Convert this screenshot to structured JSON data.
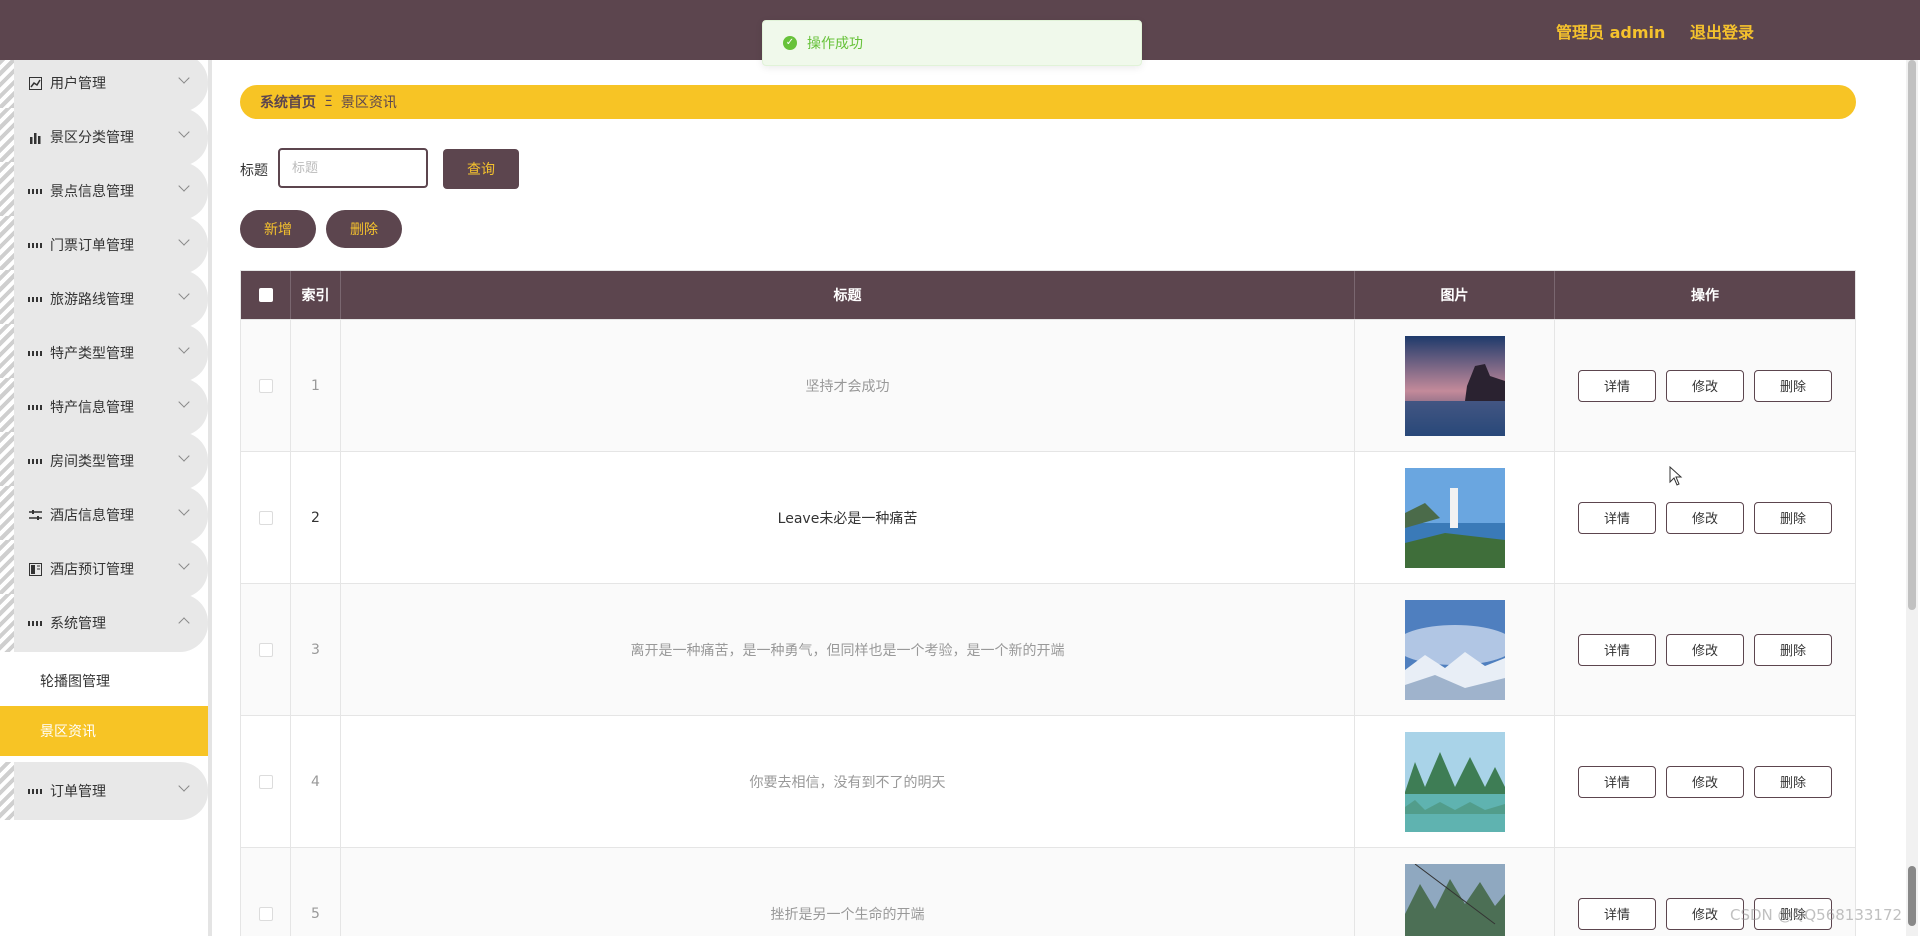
{
  "header": {
    "user": "管理员 admin",
    "logout": "退出登录"
  },
  "toast": {
    "message": "操作成功"
  },
  "sidebar": {
    "items": [
      {
        "label": "用户管理",
        "icon": "chart-line-icon"
      },
      {
        "label": "景区分类管理",
        "icon": "bar-chart-icon"
      },
      {
        "label": "景点信息管理",
        "icon": "grid-icon"
      },
      {
        "label": "门票订单管理",
        "icon": "grid-icon"
      },
      {
        "label": "旅游路线管理",
        "icon": "grid-icon"
      },
      {
        "label": "特产类型管理",
        "icon": "grid-icon"
      },
      {
        "label": "特产信息管理",
        "icon": "grid-icon"
      },
      {
        "label": "房间类型管理",
        "icon": "grid-icon"
      },
      {
        "label": "酒店信息管理",
        "icon": "sliders-icon"
      },
      {
        "label": "酒店预订管理",
        "icon": "book-icon"
      },
      {
        "label": "系统管理",
        "icon": "grid-icon"
      },
      {
        "label": "订单管理",
        "icon": "grid-icon"
      }
    ],
    "sub_items": [
      {
        "label": "轮播图管理"
      },
      {
        "label": "景区资讯"
      }
    ]
  },
  "breadcrumb": {
    "home": "系统首页",
    "separator": "Ξ",
    "current": "景区资讯"
  },
  "search": {
    "label": "标题",
    "placeholder": "标题",
    "button": "查询"
  },
  "actions": {
    "add": "新增",
    "delete": "删除"
  },
  "table": {
    "columns": [
      "索引",
      "标题",
      "图片",
      "操作"
    ],
    "row_buttons": {
      "detail": "详情",
      "edit": "修改",
      "delete": "删除"
    },
    "rows": [
      {
        "index": "1",
        "title": "坚持才会成功"
      },
      {
        "index": "2",
        "title": "Leave未必是一种痛苦"
      },
      {
        "index": "3",
        "title": "离开是一种痛苦，是一种勇气，但同样也是一个考验，是一个新的开端"
      },
      {
        "index": "4",
        "title": "你要去相信，没有到不了的明天"
      },
      {
        "index": "5",
        "title": "挫折是另一个生命的开端"
      }
    ]
  },
  "watermark": "CSDN @QQ568133172",
  "colors": {
    "header_bg": "#5c454e",
    "accent": "#f7c425",
    "success": "#67c23a"
  }
}
